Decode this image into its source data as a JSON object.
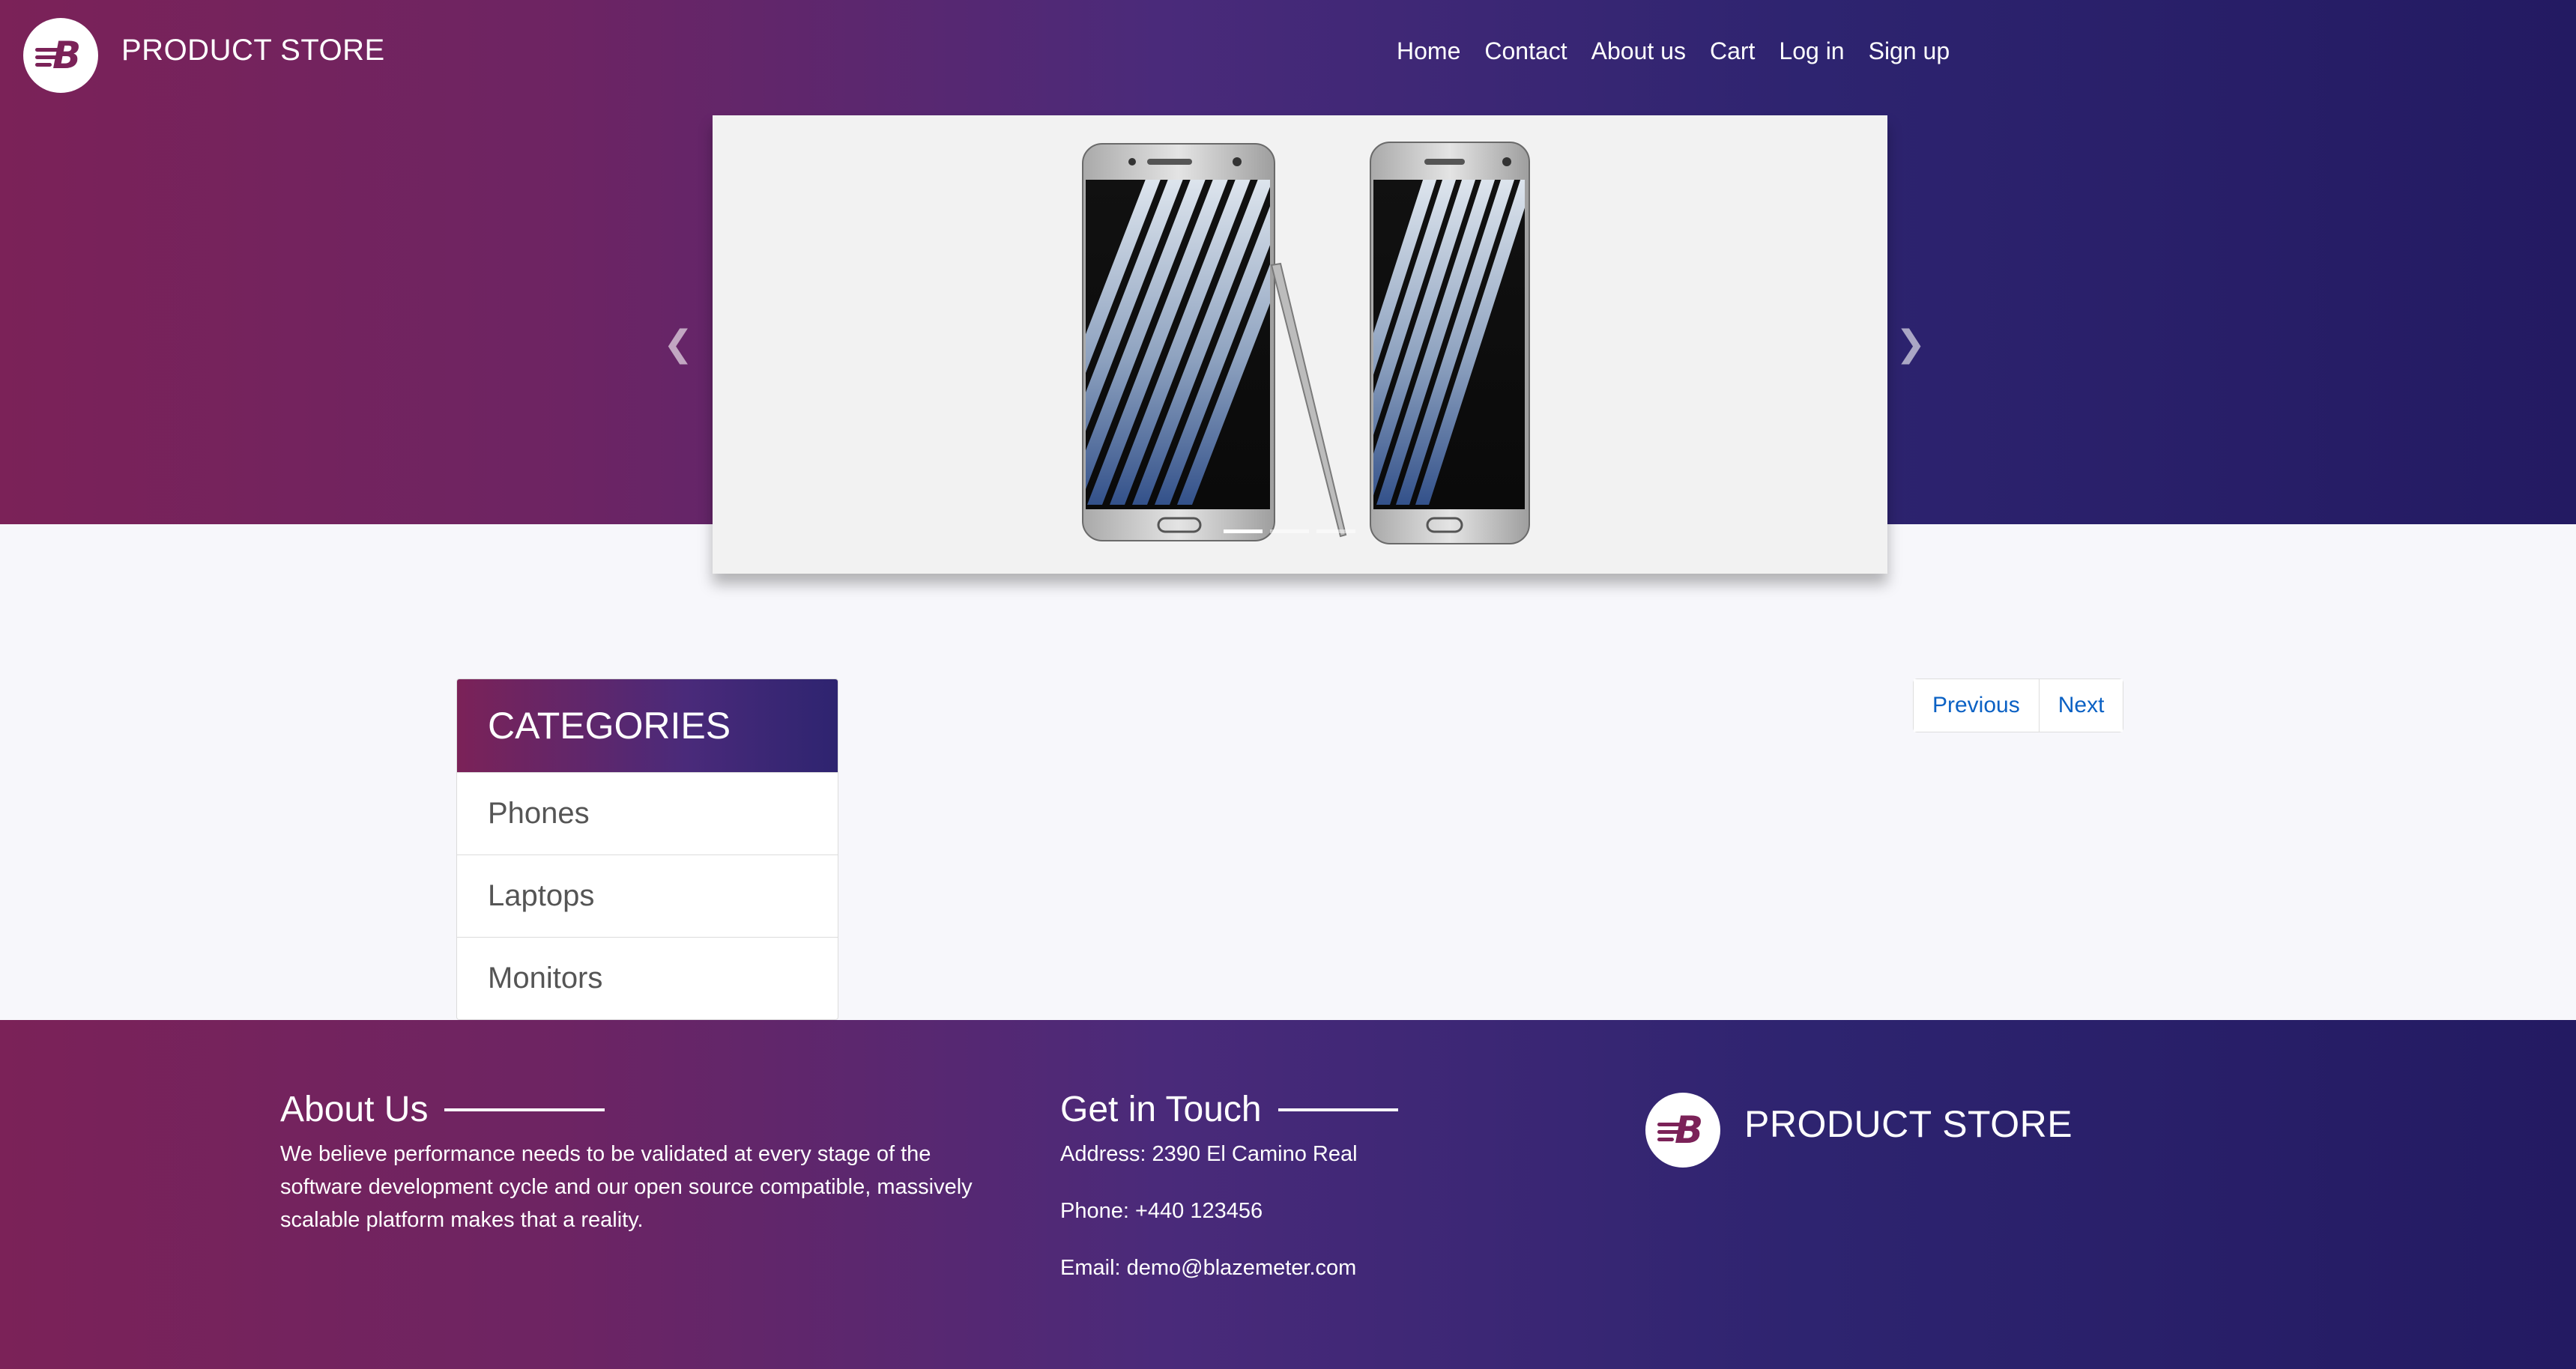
{
  "brand": {
    "name": "PRODUCT STORE",
    "logo_letter": "B"
  },
  "nav": {
    "items": [
      {
        "label": "Home"
      },
      {
        "label": "Contact"
      },
      {
        "label": "About us"
      },
      {
        "label": "Cart"
      },
      {
        "label": "Log in"
      },
      {
        "label": "Sign up"
      }
    ]
  },
  "carousel": {
    "prev_icon": "chevron-left-icon",
    "next_icon": "chevron-right-icon",
    "image": "samsung-phones-with-stylus"
  },
  "categories": {
    "title": "CATEGORIES",
    "items": [
      {
        "label": "Phones"
      },
      {
        "label": "Laptops"
      },
      {
        "label": "Monitors"
      }
    ]
  },
  "pager": {
    "previous_label": "Previous",
    "next_label": "Next"
  },
  "footer": {
    "about": {
      "title": "About Us",
      "text": "We believe performance needs to be validated at every stage of the software development cycle and our open source compatible, massively scalable platform makes that a reality."
    },
    "contact": {
      "title": "Get in Touch",
      "address": "Address: 2390 El Camino Real",
      "phone": "Phone: +440 123456",
      "email": "Email: demo@blazemeter.com"
    },
    "brand_name": "PRODUCT STORE"
  },
  "colors": {
    "gradient_start": "#7b2258",
    "gradient_end": "#231a62",
    "link_blue": "#0b61c4"
  }
}
